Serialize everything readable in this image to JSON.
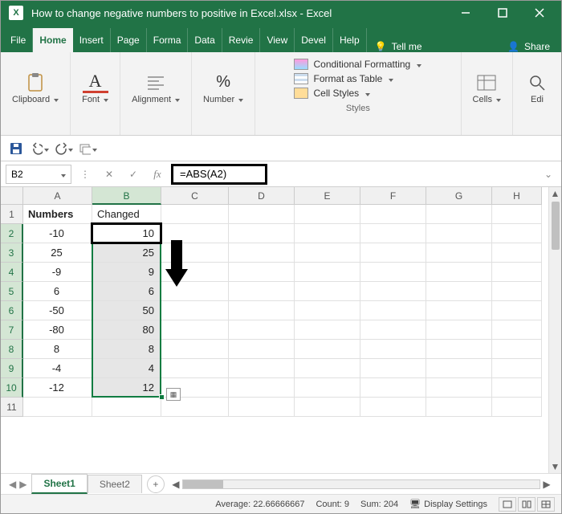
{
  "title": "How to change negative numbers to positive in Excel.xlsx  -  Excel",
  "tabs": [
    "File",
    "Home",
    "Insert",
    "Page",
    "Forma",
    "Data",
    "Revie",
    "View",
    "Devel",
    "Help"
  ],
  "active_tab": "Home",
  "tell_me": "Tell me",
  "share": "Share",
  "ribbon": {
    "clipboard": "Clipboard",
    "font": "Font",
    "font_letter": "A",
    "alignment": "Alignment",
    "number": "Number",
    "number_sign": "%",
    "styles_label": "Styles",
    "cond_fmt": "Conditional Formatting",
    "fmt_table": "Format as Table",
    "cell_styles": "Cell Styles",
    "cells": "Cells",
    "editing": "Edi"
  },
  "name_box": "B2",
  "formula": "=ABS(A2)",
  "columns": [
    "A",
    "B",
    "C",
    "D",
    "E",
    "F",
    "G",
    "H"
  ],
  "rows": [
    "1",
    "2",
    "3",
    "4",
    "5",
    "6",
    "7",
    "8",
    "9",
    "10",
    "11"
  ],
  "headers": {
    "a1": "Numbers",
    "b1": "Changed"
  },
  "dataA": [
    "-10",
    "25",
    "-9",
    "6",
    "-50",
    "-80",
    "8",
    "-4",
    "-12"
  ],
  "dataB": [
    "10",
    "25",
    "9",
    "6",
    "50",
    "80",
    "8",
    "4",
    "12"
  ],
  "sheets": [
    "Sheet1",
    "Sheet2"
  ],
  "active_sheet": "Sheet1",
  "status": {
    "average_label": "Average:",
    "average": "22.66666667",
    "count_label": "Count:",
    "count": "9",
    "sum_label": "Sum:",
    "sum": "204",
    "display": "Display Settings"
  },
  "chart_data": {
    "type": "table",
    "columns": [
      "Numbers",
      "Changed"
    ],
    "rows": [
      [
        -10,
        10
      ],
      [
        25,
        25
      ],
      [
        -9,
        9
      ],
      [
        6,
        6
      ],
      [
        -50,
        50
      ],
      [
        -80,
        80
      ],
      [
        8,
        8
      ],
      [
        -4,
        4
      ],
      [
        -12,
        12
      ]
    ],
    "formula_B": "=ABS(A2)",
    "selection": "B2:B10",
    "active_cell": "B2",
    "stats": {
      "average": 22.66666667,
      "count": 9,
      "sum": 204
    }
  }
}
